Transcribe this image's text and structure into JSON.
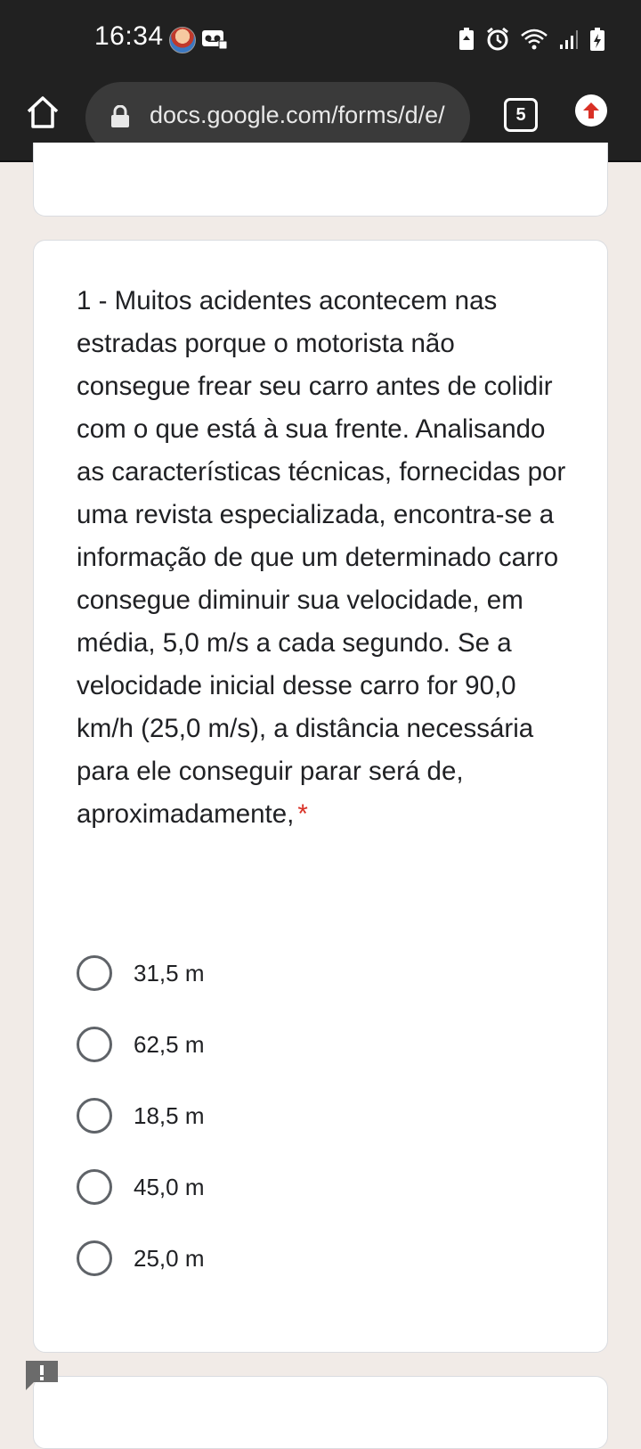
{
  "status_bar": {
    "time": "16:34"
  },
  "browser": {
    "url": "docs.google.com/forms/d/e/",
    "tab_count": "5"
  },
  "question": {
    "text": "1 - Muitos acidentes acontecem nas estradas porque o motorista não consegue frear seu carro antes de colidir com o que está à sua frente. Analisando as características técnicas, fornecidas por uma revista especializada, encontra-se a informação de que um determinado carro consegue diminuir sua velocidade, em média, 5,0 m/s a cada segundo. Se a velocidade inicial desse carro for 90,0 km/h (25,0 m/s), a distância necessária para ele conseguir parar será de, aproximadamente,",
    "required_marker": "*",
    "options": [
      "31,5 m",
      "62,5 m",
      "18,5 m",
      "45,0 m",
      "25,0 m"
    ]
  },
  "colors": {
    "status_bar_bg": "#212121",
    "page_bg": "#f1ebe7",
    "required": "#d93025",
    "update_badge": "#d93025"
  },
  "icons": {
    "home": "home-icon",
    "lock": "lock-icon",
    "update": "arrow-up-icon",
    "feedback": "feedback-icon"
  }
}
